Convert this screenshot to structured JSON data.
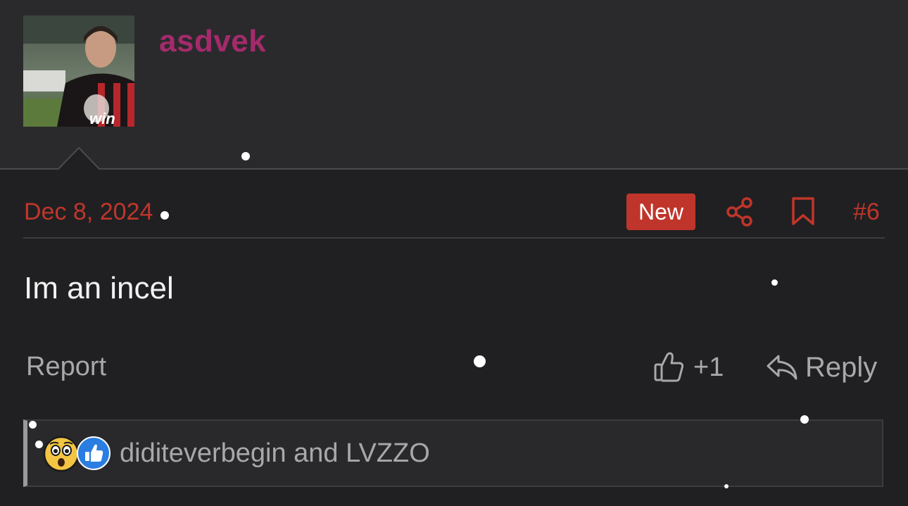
{
  "post": {
    "username": "asdvek",
    "date": "Dec 8, 2024",
    "badge": "New",
    "post_number": "#6",
    "message": "Im an incel"
  },
  "actions": {
    "report_label": "Report",
    "like_count": "+1",
    "reply_label": "Reply"
  },
  "reactions": {
    "reactors_text": "diditeverbegin and LVZZO",
    "emojis": [
      "wow-emoji",
      "like-emoji"
    ]
  },
  "colors": {
    "accent": "#c0352b",
    "username": "#a52a6c",
    "background": "#202022",
    "header_bg": "#2a2a2c",
    "muted_text": "#a8a8aa"
  }
}
